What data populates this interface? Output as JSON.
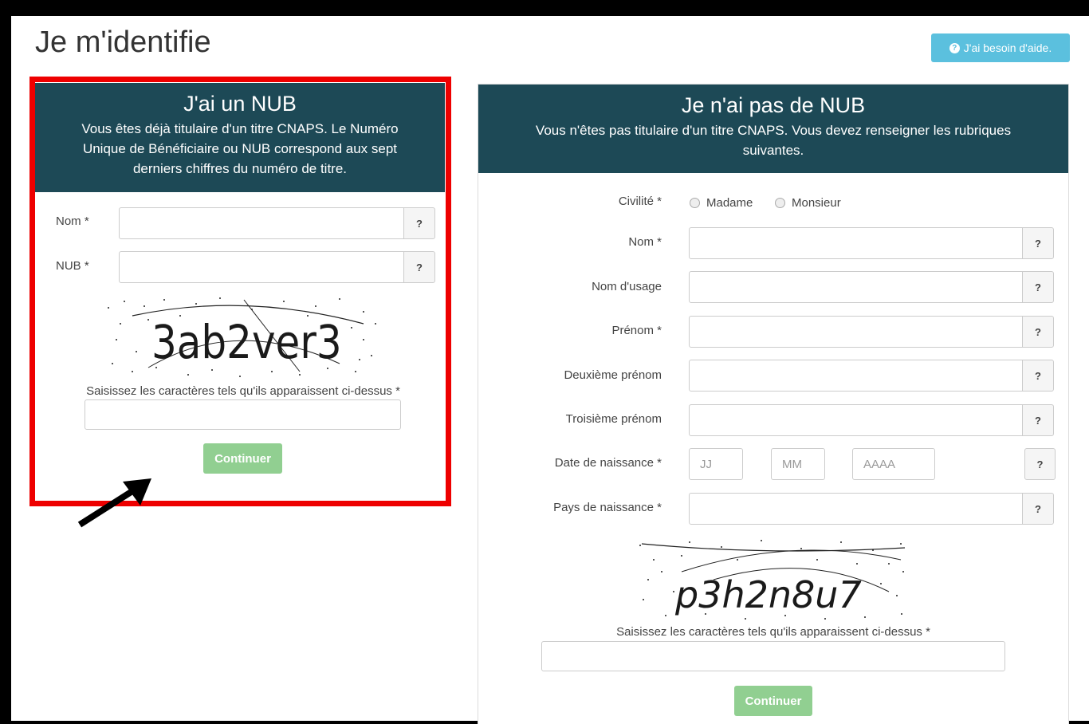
{
  "page": {
    "title": "Je m'identifie",
    "help_button": "J'ai besoin d'aide."
  },
  "nub_panel": {
    "title": "J'ai un NUB",
    "description": "Vous êtes déjà titulaire d'un titre CNAPS. Le Numéro Unique de Bénéficiaire ou NUB correspond aux sept derniers chiffres du numéro de titre.",
    "fields": [
      {
        "label": "Nom *",
        "help": "?"
      },
      {
        "label": "NUB *",
        "help": "?"
      }
    ],
    "captcha_text": "3ab2ver3",
    "captcha_hint": "Saisissez les caractères tels qu'ils apparaissent ci-dessus *",
    "continue_label": "Continuer"
  },
  "no_nub_panel": {
    "title": "Je n'ai pas de NUB",
    "description": "Vous n'êtes pas titulaire d'un titre CNAPS. Vous devez renseigner les rubriques suivantes.",
    "civility_label": "Civilité *",
    "civility_options": [
      "Madame",
      "Monsieur"
    ],
    "fields": [
      {
        "label": "Nom *",
        "help": "?"
      },
      {
        "label": "Nom d'usage",
        "help": "?"
      },
      {
        "label": "Prénom *",
        "help": "?"
      },
      {
        "label": "Deuxième prénom",
        "help": "?"
      },
      {
        "label": "Troisième prénom",
        "help": "?"
      }
    ],
    "birth_date": {
      "label": "Date de naissance *",
      "day_placeholder": "JJ",
      "month_placeholder": "MM",
      "year_placeholder": "AAAA",
      "help": "?"
    },
    "birth_country": {
      "label": "Pays de naissance *",
      "help": "?"
    },
    "captcha_text": "p3h2n8u7",
    "captcha_hint": "Saisissez les caractères tels qu'ils apparaissent ci-dessus *",
    "continue_label": "Continuer"
  },
  "colors": {
    "panel_header": "#1d4956",
    "highlight_border": "#ee0000",
    "help_button": "#5bc0de",
    "continue_button": "#91cf91"
  },
  "icons": [
    "question-circle-icon",
    "annotation-arrow-icon"
  ]
}
